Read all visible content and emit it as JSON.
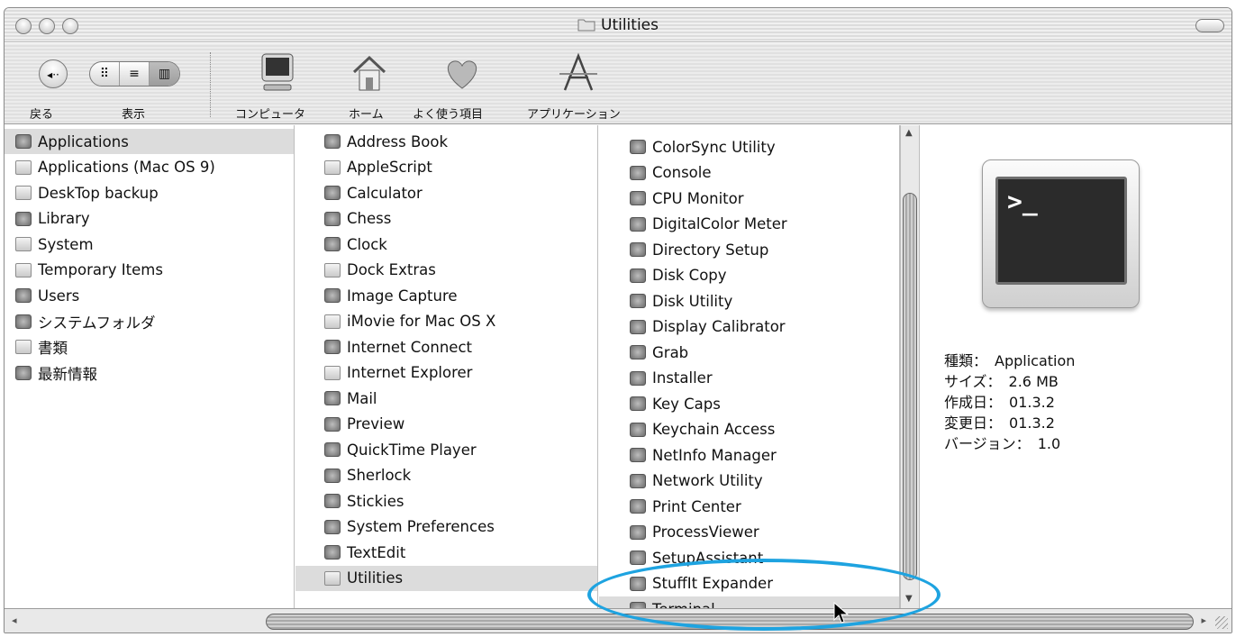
{
  "window": {
    "title": "Utilities"
  },
  "toolbar": {
    "back_label": "戻る",
    "view_label": "表示",
    "computer_label": "コンピュータ",
    "home_label": "ホーム",
    "favorites_label": "よく使う項目",
    "applications_label": "アプリケーション"
  },
  "col1": [
    {
      "label": "Applications",
      "icon": "applications-folder-icon",
      "selected": true
    },
    {
      "label": "Applications (Mac OS 9)",
      "icon": "folder-icon"
    },
    {
      "label": "DeskTop backup",
      "icon": "folder-icon"
    },
    {
      "label": "Library",
      "icon": "library-folder-icon"
    },
    {
      "label": "System",
      "icon": "folder-icon"
    },
    {
      "label": "Temporary Items",
      "icon": "folder-icon"
    },
    {
      "label": "Users",
      "icon": "users-folder-icon"
    },
    {
      "label": "システムフォルダ",
      "icon": "system-folder-icon"
    },
    {
      "label": "書類",
      "icon": "folder-icon"
    },
    {
      "label": "最新情報",
      "icon": "help-document-icon"
    }
  ],
  "col2": [
    {
      "label": "Address Book",
      "icon": "address-book-icon"
    },
    {
      "label": "AppleScript",
      "icon": "folder-icon"
    },
    {
      "label": "Calculator",
      "icon": "calculator-icon"
    },
    {
      "label": "Chess",
      "icon": "chess-icon"
    },
    {
      "label": "Clock",
      "icon": "clock-icon"
    },
    {
      "label": "Dock Extras",
      "icon": "folder-icon"
    },
    {
      "label": "Image Capture",
      "icon": "image-capture-icon"
    },
    {
      "label": "iMovie for Mac OS X",
      "icon": "folder-icon"
    },
    {
      "label": "Internet Connect",
      "icon": "internet-connect-icon"
    },
    {
      "label": "Internet Explorer",
      "icon": "folder-icon"
    },
    {
      "label": "Mail",
      "icon": "mail-icon"
    },
    {
      "label": "Preview",
      "icon": "preview-icon"
    },
    {
      "label": "QuickTime Player",
      "icon": "quicktime-icon"
    },
    {
      "label": "Sherlock",
      "icon": "sherlock-icon"
    },
    {
      "label": "Stickies",
      "icon": "stickies-icon"
    },
    {
      "label": "System Preferences",
      "icon": "system-preferences-icon"
    },
    {
      "label": "TextEdit",
      "icon": "textedit-icon"
    },
    {
      "label": "Utilities",
      "icon": "folder-icon",
      "selected": true
    }
  ],
  "col3": [
    {
      "label": "ColorSync Utility",
      "icon": "colorsync-icon"
    },
    {
      "label": "Console",
      "icon": "console-icon"
    },
    {
      "label": "CPU Monitor",
      "icon": "cpu-monitor-icon"
    },
    {
      "label": "DigitalColor Meter",
      "icon": "digitalcolor-meter-icon"
    },
    {
      "label": "Directory Setup",
      "icon": "directory-setup-icon"
    },
    {
      "label": "Disk Copy",
      "icon": "disk-copy-icon"
    },
    {
      "label": "Disk Utility",
      "icon": "disk-utility-icon"
    },
    {
      "label": "Display Calibrator",
      "icon": "display-calibrator-icon"
    },
    {
      "label": "Grab",
      "icon": "grab-icon"
    },
    {
      "label": "Installer",
      "icon": "installer-icon"
    },
    {
      "label": "Key Caps",
      "icon": "key-caps-icon"
    },
    {
      "label": "Keychain Access",
      "icon": "keychain-icon"
    },
    {
      "label": "NetInfo Manager",
      "icon": "netinfo-icon"
    },
    {
      "label": "Network Utility",
      "icon": "network-utility-icon"
    },
    {
      "label": "Print Center",
      "icon": "print-center-icon"
    },
    {
      "label": "ProcessViewer",
      "icon": "processviewer-icon"
    },
    {
      "label": "SetupAssistant",
      "icon": "setup-assistant-icon"
    },
    {
      "label": "StuffIt Expander",
      "icon": "stuffit-icon"
    },
    {
      "label": "Terminal",
      "icon": "terminal-icon",
      "selected": true
    }
  ],
  "preview": {
    "prompt_glyph": ">_",
    "kind_label": "種類：",
    "kind_value": "Application",
    "size_label": "サイズ：",
    "size_value": "2.6 MB",
    "created_label": "作成日：",
    "created_value": "01.3.2",
    "modified_label": "変更日：",
    "modified_value": "01.3.2",
    "version_label": "バージョン：",
    "version_value": "1.0"
  },
  "colors": {
    "highlight": "#1ea3e0",
    "selection": "#dcdcdc"
  }
}
